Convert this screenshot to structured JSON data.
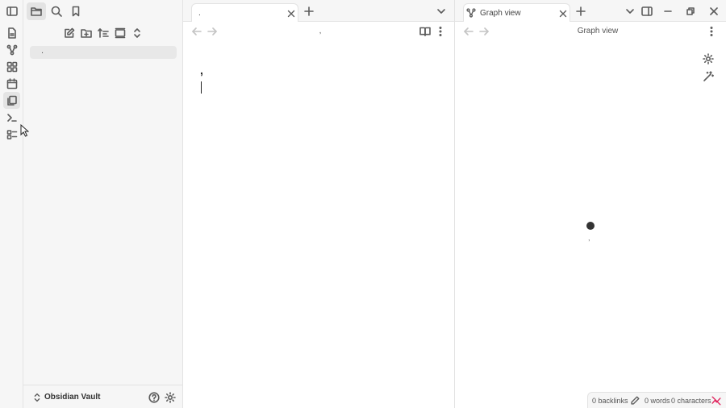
{
  "sidebar": {
    "file_item": "."
  },
  "vault": {
    "name": "Obsidian Vault"
  },
  "left_pane": {
    "tab_title": ".",
    "header_title": ",",
    "editor_text": ","
  },
  "right_pane": {
    "tab_title": "Graph view",
    "header_title": "Graph view",
    "node_label": ","
  },
  "status": {
    "backlinks": "0 backlinks",
    "words": "0 words",
    "characters": "0 characters"
  },
  "colors": {
    "chrome": "#f6f6f6",
    "border": "#e3e3e3",
    "icon": "#5c5c5c",
    "node": "#333333",
    "sync_error": "#e0245e"
  },
  "icons": {
    "ribbon": [
      "file-icon",
      "graph-icon",
      "canvas-icon",
      "calendar-icon",
      "templates-icon",
      "terminal-icon",
      "command-palette-icon"
    ],
    "sidebar_top": [
      "folder-icon",
      "search-icon",
      "bookmark-icon"
    ],
    "file_actions": [
      "new-note-icon",
      "new-folder-icon",
      "sort-icon",
      "collapse-all-icon",
      "expand-all-icon"
    ]
  }
}
